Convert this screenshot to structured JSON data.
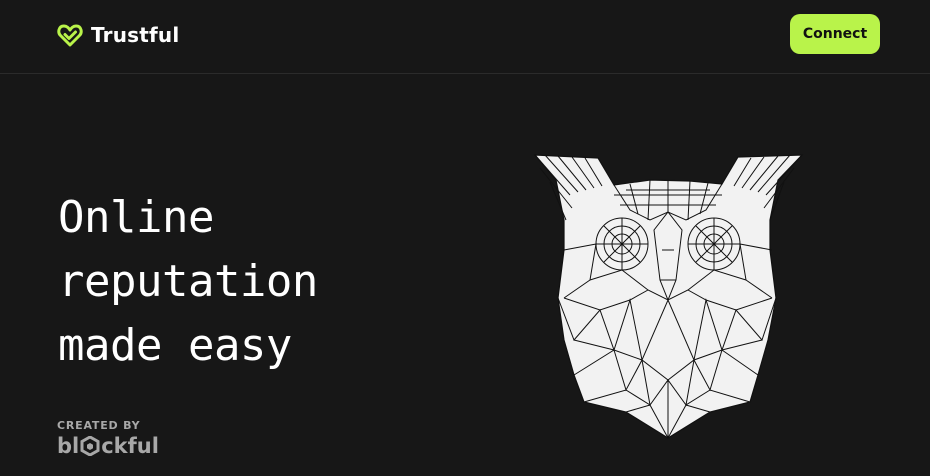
{
  "header": {
    "brand": "Trustful",
    "brand_icon": "heart-check-icon",
    "accent_color": "#b9f34a",
    "connect_label": "Connect"
  },
  "hero": {
    "title_lines": [
      "Online",
      "reputation",
      "made easy"
    ]
  },
  "footer": {
    "created_by": "CREATED BY",
    "creator_prefix": "bl",
    "creator_suffix": "ckful",
    "creator_icon": "cube-logo-icon"
  },
  "illustration": {
    "icon": "polygonal-owl-illustration"
  }
}
